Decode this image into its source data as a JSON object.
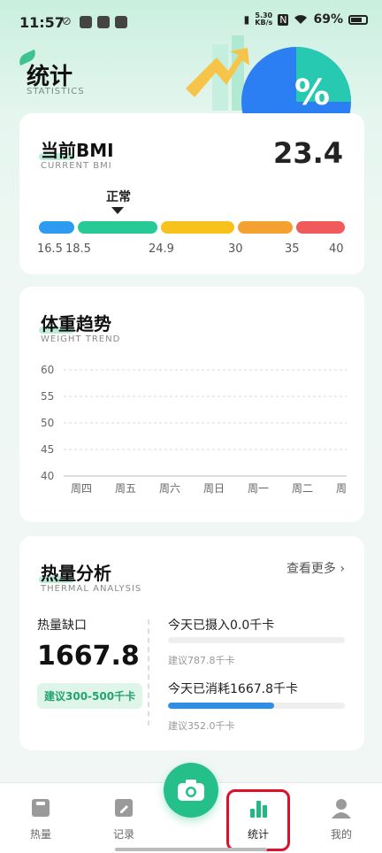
{
  "status_bar": {
    "time": "11:57",
    "network_speed_top": "5.30",
    "network_speed_unit": "KB/s",
    "battery": "69%"
  },
  "hero": {
    "title": "统计",
    "subtitle": "STATISTICS"
  },
  "bmi": {
    "title": "当前BMI",
    "subtitle": "CURRENT BMI",
    "value": "23.4",
    "status": "正常",
    "ticks": [
      "16.5",
      "18.5",
      "24.9",
      "30",
      "35",
      "40"
    ],
    "segment_colors": [
      "#2d9cf0",
      "#27c995",
      "#f7c21c",
      "#f5a132",
      "#f05a5a"
    ]
  },
  "weight": {
    "title": "体重趋势",
    "subtitle": "WEIGHT TREND"
  },
  "chart_data": {
    "type": "line",
    "categories": [
      "周四",
      "周五",
      "周六",
      "周日",
      "周一",
      "周二",
      "周三"
    ],
    "series": [],
    "yticks": [
      "60",
      "55",
      "50",
      "45",
      "40"
    ],
    "ylim": [
      40,
      60
    ],
    "grid": true
  },
  "thermal": {
    "title": "热量分析",
    "subtitle": "THERMAL ANALYSIS",
    "more": "查看更多",
    "gap_label": "热量缺口",
    "gap_value": "1667.8",
    "gap_suggestion": "建议300-500千卡",
    "intake_label": "今天已摄入0.0千卡",
    "intake_suggestion": "建议787.8千卡",
    "intake_progress": 0,
    "burn_label": "今天已消耗1667.8千卡",
    "burn_suggestion": "建议352.0千卡",
    "burn_progress": 0.6
  },
  "nav": {
    "items": [
      {
        "label": "热量",
        "icon": "scale-icon"
      },
      {
        "label": "记录",
        "icon": "edit-icon"
      },
      {
        "label": "统计",
        "icon": "bar-chart-icon"
      },
      {
        "label": "我的",
        "icon": "user-icon"
      }
    ],
    "active": "统计"
  }
}
